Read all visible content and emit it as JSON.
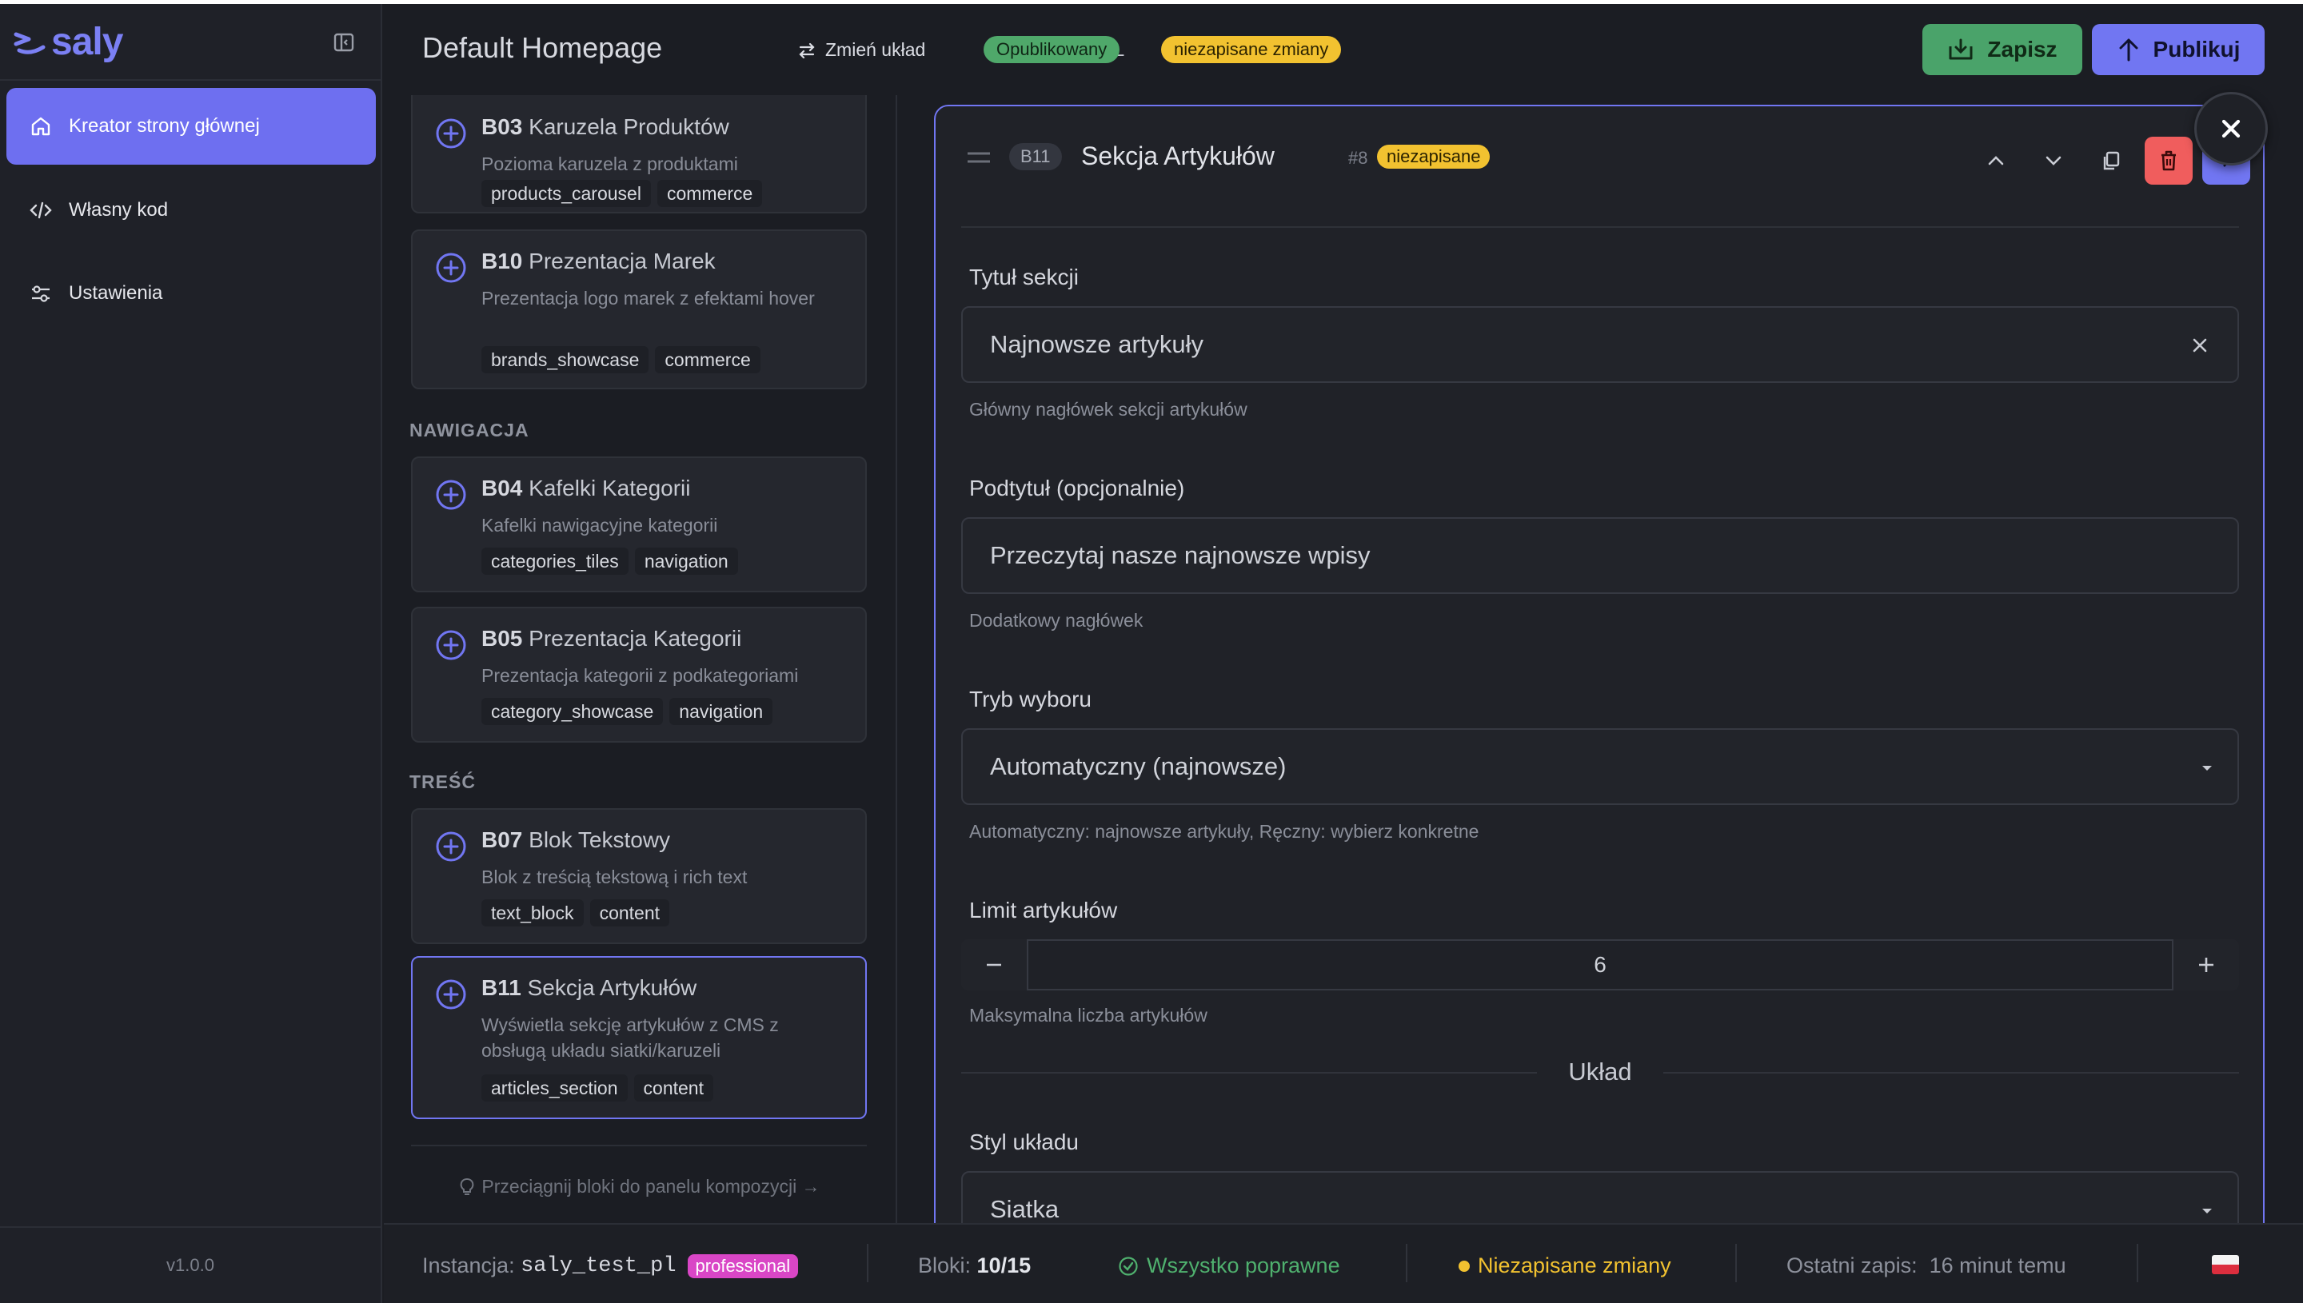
{
  "app": {
    "logo_text": "saly",
    "version": "v1.0.0"
  },
  "sidebar": {
    "items": [
      {
        "label": "Kreator strony głównej",
        "icon": "home-icon",
        "active": true
      },
      {
        "label": "Własny kod",
        "icon": "code-icon",
        "active": false
      },
      {
        "label": "Ustawienia",
        "icon": "sliders-icon",
        "active": false
      }
    ]
  },
  "header": {
    "title": "Default Homepage",
    "language": "PL",
    "change_layout": "Zmień układ",
    "status_published": "Opublikowany",
    "status_unsaved": "niezapisane zmiany",
    "save_label": "Zapisz",
    "publish_label": "Publikuj",
    "colors": {
      "save": "#4aa36a",
      "publish": "#7176f2",
      "published_badge": "#4fa86a",
      "unsaved_badge": "#f2c230"
    }
  },
  "library": {
    "blocks_top": [
      {
        "code": "B03",
        "name": "Karuzela Produktów",
        "desc": "Pozioma karuzela z produktami",
        "tags": [
          "products_carousel",
          "commerce"
        ]
      },
      {
        "code": "B10",
        "name": "Prezentacja Marek",
        "desc": "Prezentacja logo marek z efektami hover",
        "tags": [
          "brands_showcase",
          "commerce"
        ]
      }
    ],
    "section_navigation": "NAWIGACJA",
    "blocks_navigation": [
      {
        "code": "B04",
        "name": "Kafelki Kategorii",
        "desc": "Kafelki nawigacyjne kategorii",
        "tags": [
          "categories_tiles",
          "navigation"
        ]
      },
      {
        "code": "B05",
        "name": "Prezentacja Kategorii",
        "desc": "Prezentacja kategorii z podkategoriami",
        "tags": [
          "category_showcase",
          "navigation"
        ]
      }
    ],
    "section_content": "TREŚĆ",
    "blocks_content": [
      {
        "code": "B07",
        "name": "Blok Tekstowy",
        "desc": "Blok z treścią tekstową i rich text",
        "tags": [
          "text_block",
          "content"
        ]
      },
      {
        "code": "B11",
        "name": "Sekcja Artykułów",
        "desc": "Wyświetla sekcję artykułów z CMS z obsługą układu siatki/karuzeli",
        "tags": [
          "articles_section",
          "content"
        ],
        "selected": true
      }
    ],
    "drag_hint": "Przeciągnij bloki do panelu kompozycji →"
  },
  "editor": {
    "block_code": "B11",
    "block_title": "Sekcja Artykułów",
    "block_number": "#8",
    "badge": "niezapisane",
    "fields": {
      "title_label": "Tytuł sekcji",
      "title_value": "Najnowsze artykuły",
      "title_help": "Główny nagłówek sekcji artykułów",
      "subtitle_label": "Podtytuł (opcjonalnie)",
      "subtitle_value": "Przeczytaj nasze najnowsze wpisy",
      "subtitle_help": "Dodatkowy nagłówek",
      "mode_label": "Tryb wyboru",
      "mode_value": "Automatyczny (najnowsze)",
      "mode_help": "Automatyczny: najnowsze artykuły, Ręczny: wybierz konkretne",
      "limit_label": "Limit artykułów",
      "limit_value": "6",
      "limit_help": "Maksymalna liczba artykułów",
      "layout_section": "Układ",
      "layout_style_label": "Styl układu",
      "layout_style_value": "Siatka"
    }
  },
  "footer": {
    "instance_label": "Instancja:",
    "instance_value": "saly_test_pl",
    "plan": "professional",
    "blocks_label": "Bloki:",
    "blocks_value": "10/15",
    "all_ok": "Wszystko poprawne",
    "unsaved": "Niezapisane zmiany",
    "last_save_label": "Ostatni zapis:",
    "last_save_value": "16 minut temu",
    "flag": "poland-flag-icon"
  }
}
